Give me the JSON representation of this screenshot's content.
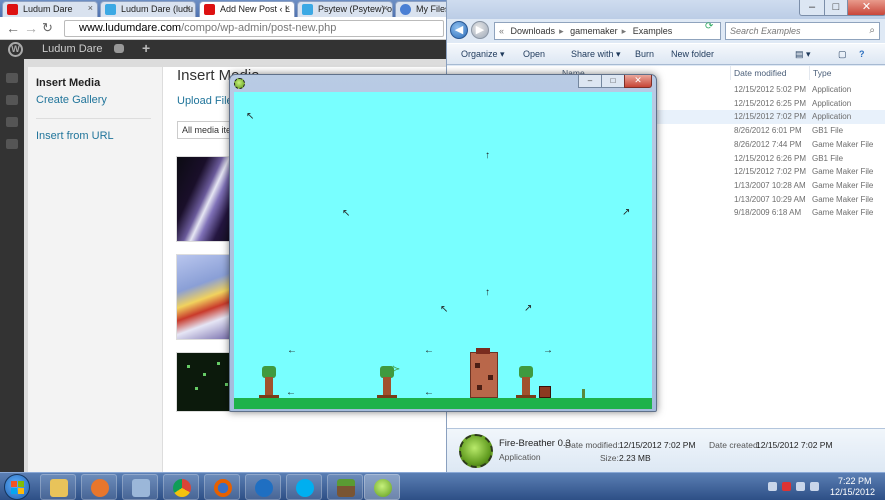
{
  "browser": {
    "tabs": [
      {
        "label": "Ludum Dare",
        "icon": "ludum-dare-icon",
        "color": "#d11"
      },
      {
        "label": "Ludum Dare (ludu",
        "icon": "twitter-icon",
        "color": "#3ca9e4"
      },
      {
        "label": "Add New Post ‹ L",
        "icon": "ludum-dare-icon",
        "color": "#d11"
      },
      {
        "label": "Psytew (Psytew) o",
        "icon": "twitter-icon",
        "color": "#3ca9e4"
      },
      {
        "label": "My Files",
        "icon": "globe-icon",
        "color": "#4a7fd4"
      }
    ],
    "url_domain": "www.ludumdare.com",
    "url_path": "/compo/wp-admin/post-new.php",
    "adminbar": {
      "site": "Ludum Dare"
    },
    "media": {
      "sidebar_title": "Insert Media",
      "create_gallery": "Create Gallery",
      "insert_from_url": "Insert from URL",
      "title": "Insert Media",
      "upload_tab": "Upload Files",
      "filter": "All media ite"
    }
  },
  "explorer": {
    "path": [
      "Downloads",
      "gamemaker",
      "Examples"
    ],
    "search_placeholder": "Search Examples",
    "toolbar": {
      "organize": "Organize ▾",
      "open": "Open",
      "share": "Share with ▾",
      "burn": "Burn",
      "new_folder": "New folder"
    },
    "columns": {
      "name": "Name",
      "date": "Date modified",
      "type": "Type"
    },
    "rows": [
      {
        "date": "12/15/2012 5:02 PM",
        "type": "Application"
      },
      {
        "date": "12/15/2012 6:25 PM",
        "type": "Application"
      },
      {
        "date": "12/15/2012 7:02 PM",
        "type": "Application"
      },
      {
        "date": "8/26/2012 6:01 PM",
        "type": "GB1 File"
      },
      {
        "date": "8/26/2012 7:44 PM",
        "type": "Game Maker File"
      },
      {
        "date": "12/15/2012 6:26 PM",
        "type": "GB1 File"
      },
      {
        "date": "12/15/2012 7:02 PM",
        "type": "Game Maker File"
      },
      {
        "date": "1/13/2007 10:28 AM",
        "type": "Game Maker File"
      },
      {
        "date": "1/13/2007 10:29 AM",
        "type": "Game Maker File"
      },
      {
        "date": "9/18/2009 6:18 AM",
        "type": "Game Maker File"
      }
    ],
    "details": {
      "name": "Fire-Breather 0.3",
      "kind": "Application",
      "modified_label": "Date modified:",
      "modified": "12/15/2012 7:02 PM",
      "created_label": "Date created:",
      "created": "12/15/2012 7:02 PM",
      "size_label": "Size:",
      "size": "2.23 MB"
    }
  },
  "game": {
    "arrows": {
      "nw": "↖",
      "ne": "↗",
      "up": "↑",
      "left": "←",
      "right": "→"
    }
  },
  "taskbar": {
    "time": "7:22 PM",
    "date": "12/15/2012",
    "apps": [
      "explorer-icon",
      "media-player-icon",
      "paint-icon",
      "chrome-icon",
      "firefox-icon",
      "maxthon-icon",
      "skype-icon",
      "minecraft-icon",
      "game-maker-icon"
    ]
  },
  "colors": {
    "game_sky": "#78ffff",
    "game_ground": "#1eb24b",
    "wp_link": "#21759b",
    "wp_adminbar": "#333333"
  }
}
